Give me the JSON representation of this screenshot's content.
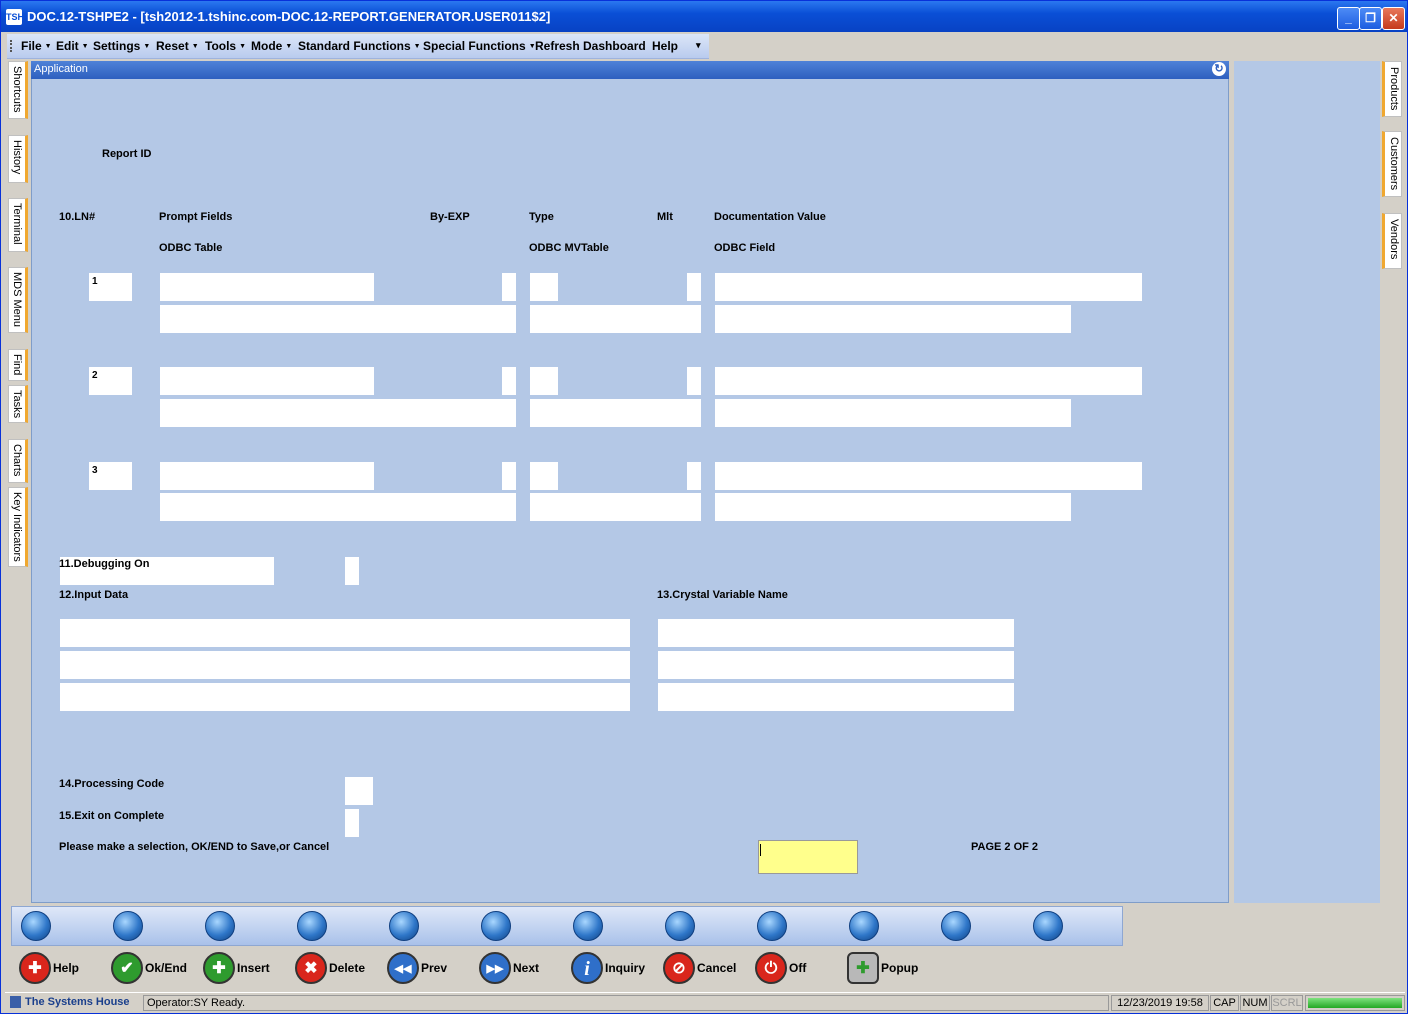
{
  "window": {
    "title": "DOC.12-TSHPE2 - [tsh2012-1.tshinc.com-DOC.12-REPORT.GENERATOR.USER011$2]",
    "minimize": "_",
    "restore": "❐",
    "close": "✕",
    "logo": "TSH"
  },
  "menu": {
    "items": [
      {
        "label": "File",
        "dd": "▼"
      },
      {
        "label": "Edit",
        "dd": "▼"
      },
      {
        "label": "Settings",
        "dd": "▼"
      },
      {
        "label": "Reset",
        "dd": "▼"
      },
      {
        "label": "Tools",
        "dd": "▼"
      },
      {
        "label": "Mode",
        "dd": "▼"
      },
      {
        "label": "Standard Functions",
        "dd": "▼"
      },
      {
        "label": "Special Functions",
        "dd": "▼"
      },
      {
        "label": "Refresh Dashboard",
        "dd": ""
      },
      {
        "label": "Help",
        "dd": ""
      }
    ],
    "overflow": "▾"
  },
  "left_tabs": [
    "Shortcuts",
    "History",
    "Terminal",
    "MDS Menu",
    "Find",
    "Tasks",
    "Charts",
    "Key Indicators"
  ],
  "right_tabs": [
    "Products",
    "Customers",
    "Vendors"
  ],
  "app": {
    "title": "Application",
    "refresh_icon": "↻"
  },
  "form": {
    "report_id_label": "Report ID",
    "headers": {
      "ln": "10.LN#",
      "prompt": "Prompt Fields",
      "byexp": "By-EXP",
      "type": "Type",
      "mlt": "Mlt",
      "doc": "Documentation Value",
      "odbc_table": "ODBC Table",
      "odbc_mvtable": "ODBC MVTable",
      "odbc_field": "ODBC Field"
    },
    "lines": [
      "1",
      "2",
      "3"
    ],
    "debug_label": "11.Debugging On",
    "input_label": "12.Input Data",
    "crystal_label": "13.Crystal Variable Name",
    "processing_label": "14.Processing Code",
    "exit_label": "15.Exit on Complete",
    "prompt_msg": "Please make a selection, OK/END to Save,or Cancel",
    "page_label": "PAGE  2 OF  2"
  },
  "function_keys": [
    {
      "label": "Help",
      "icon": "lifebuoy-icon",
      "glyph": "✚",
      "color": "#d9261c"
    },
    {
      "label": "Ok/End",
      "icon": "check-icon",
      "glyph": "✔",
      "color": "#2e9b2e"
    },
    {
      "label": "Insert",
      "icon": "plus-icon",
      "glyph": "✚",
      "color": "#2e9b2e"
    },
    {
      "label": "Delete",
      "icon": "x-icon",
      "glyph": "✖",
      "color": "#d9261c"
    },
    {
      "label": "Prev",
      "icon": "rewind-icon",
      "glyph": "◀◀",
      "color": "#2f6fc9"
    },
    {
      "label": "Next",
      "icon": "forward-icon",
      "glyph": "▶▶",
      "color": "#2f6fc9"
    },
    {
      "label": "Inquiry",
      "icon": "info-icon",
      "glyph": "i",
      "color": "#2f6fc9"
    },
    {
      "label": "Cancel",
      "icon": "no-icon",
      "glyph": "⊘",
      "color": "#d9261c"
    },
    {
      "label": "Off",
      "icon": "power-icon",
      "glyph": "⏻",
      "color": "#d9261c"
    },
    {
      "label": "Popup",
      "icon": "database-add-icon",
      "glyph": "✚",
      "color": "#999999"
    }
  ],
  "status": {
    "brand": "The Systems House",
    "message": "Operator:SY Ready.",
    "datetime": "12/23/2019 19:58",
    "cap": "CAP",
    "num": "NUM",
    "scrl": "SCRL"
  }
}
